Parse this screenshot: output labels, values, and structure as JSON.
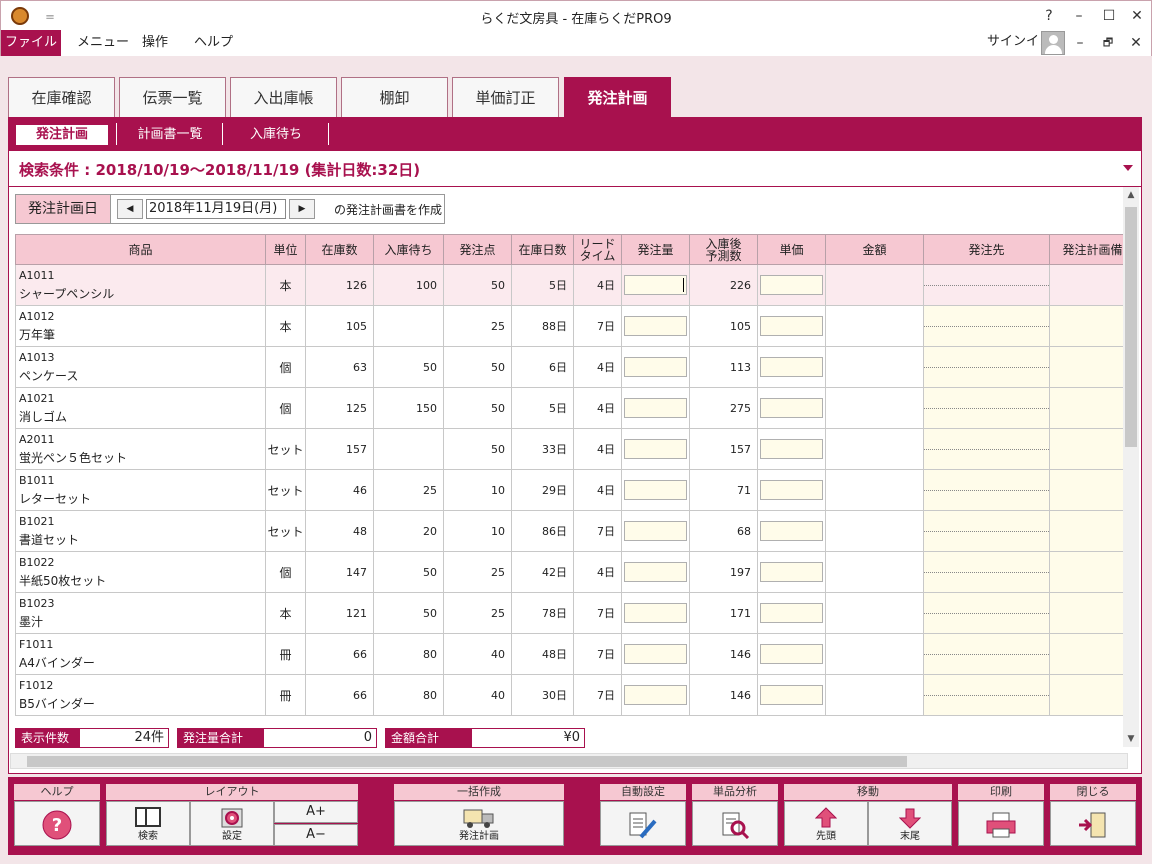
{
  "window": {
    "title": "らくだ文房具 - 在庫らくだPRO9",
    "help": "?",
    "minimize": "–",
    "maximize": "☐",
    "close": "✕",
    "qa": "＝"
  },
  "menu": {
    "file": "ファイル",
    "items": [
      "メニュー",
      "操作",
      "ヘルプ"
    ],
    "signin": "サインイン",
    "min": "–",
    "restore": "🗗",
    "close": "✕"
  },
  "tabs": [
    {
      "label": "在庫確認",
      "active": false
    },
    {
      "label": "伝票一覧",
      "active": false
    },
    {
      "label": "入出庫帳",
      "active": false
    },
    {
      "label": "棚卸",
      "active": false
    },
    {
      "label": "単価訂正",
      "active": false
    },
    {
      "label": "発注計画",
      "active": true
    }
  ],
  "subtabs": [
    {
      "label": "発注計画",
      "active": true
    },
    {
      "label": "計画書一覧",
      "active": false
    },
    {
      "label": "入庫待ち",
      "active": false
    }
  ],
  "search": {
    "text": "検索条件 : 2018/10/19～2018/11/19 (集計日数:32日)"
  },
  "date": {
    "label": "発注計画日",
    "value": "2018年11月19日(月)",
    "suffix": "の発注計画書を作成",
    "prev": "◀",
    "next": "▶"
  },
  "columns": [
    "商品",
    "単位",
    "在庫数",
    "入庫待ち",
    "発注点",
    "在庫日数",
    "リード\nタイム",
    "発注量",
    "入庫後\n予測数",
    "単価",
    "金額",
    "発注先",
    "発注計画備"
  ],
  "rows": [
    {
      "code": "A1011",
      "name": "シャープペンシル",
      "unit": "本",
      "stock": "126",
      "waiting": "100",
      "reorder": "50",
      "days": "5日",
      "lead": "4日",
      "forecast": "226"
    },
    {
      "code": "A1012",
      "name": "万年筆",
      "unit": "本",
      "stock": "105",
      "waiting": "",
      "reorder": "25",
      "days": "88日",
      "lead": "7日",
      "forecast": "105"
    },
    {
      "code": "A1013",
      "name": "ペンケース",
      "unit": "個",
      "stock": "63",
      "waiting": "50",
      "reorder": "50",
      "days": "6日",
      "lead": "4日",
      "forecast": "113"
    },
    {
      "code": "A1021",
      "name": "消しゴム",
      "unit": "個",
      "stock": "125",
      "waiting": "150",
      "reorder": "50",
      "days": "5日",
      "lead": "4日",
      "forecast": "275"
    },
    {
      "code": "A2011",
      "name": "蛍光ペン５色セット",
      "unit": "セット",
      "stock": "157",
      "waiting": "",
      "reorder": "50",
      "days": "33日",
      "lead": "4日",
      "forecast": "157"
    },
    {
      "code": "B1011",
      "name": "レターセット",
      "unit": "セット",
      "stock": "46",
      "waiting": "25",
      "reorder": "10",
      "days": "29日",
      "lead": "4日",
      "forecast": "71"
    },
    {
      "code": "B1021",
      "name": "書道セット",
      "unit": "セット",
      "stock": "48",
      "waiting": "20",
      "reorder": "10",
      "days": "86日",
      "lead": "7日",
      "forecast": "68"
    },
    {
      "code": "B1022",
      "name": "半紙50枚セット",
      "unit": "個",
      "stock": "147",
      "waiting": "50",
      "reorder": "25",
      "days": "42日",
      "lead": "4日",
      "forecast": "197"
    },
    {
      "code": "B1023",
      "name": "墨汁",
      "unit": "本",
      "stock": "121",
      "waiting": "50",
      "reorder": "25",
      "days": "78日",
      "lead": "7日",
      "forecast": "171"
    },
    {
      "code": "F1011",
      "name": "A4バインダー",
      "unit": "冊",
      "stock": "66",
      "waiting": "80",
      "reorder": "40",
      "days": "48日",
      "lead": "7日",
      "forecast": "146"
    },
    {
      "code": "F1012",
      "name": "B5バインダー",
      "unit": "冊",
      "stock": "66",
      "waiting": "80",
      "reorder": "40",
      "days": "30日",
      "lead": "7日",
      "forecast": "146"
    }
  ],
  "summary": {
    "count_label": "表示件数",
    "count": "24件",
    "qty_label": "発注量合計",
    "qty": "0",
    "amount_label": "金額合計",
    "amount": "¥0"
  },
  "toolbar": {
    "help": {
      "group": "ヘルプ"
    },
    "layout": {
      "group": "レイアウト",
      "search": "検索",
      "settings": "設定",
      "font_up": "A+",
      "font_down": "A−"
    },
    "bulk": {
      "group": "一括作成",
      "plan": "発注計画"
    },
    "auto": {
      "group": "自動設定"
    },
    "analysis": {
      "group": "単品分析"
    },
    "move": {
      "group": "移動",
      "first": "先頭",
      "last": "末尾"
    },
    "print": {
      "group": "印刷"
    },
    "close": {
      "group": "閉じる"
    }
  },
  "colors": {
    "accent": "#a8114e",
    "header_pink": "#f6c8d2",
    "input_yellow": "#fffcea"
  }
}
